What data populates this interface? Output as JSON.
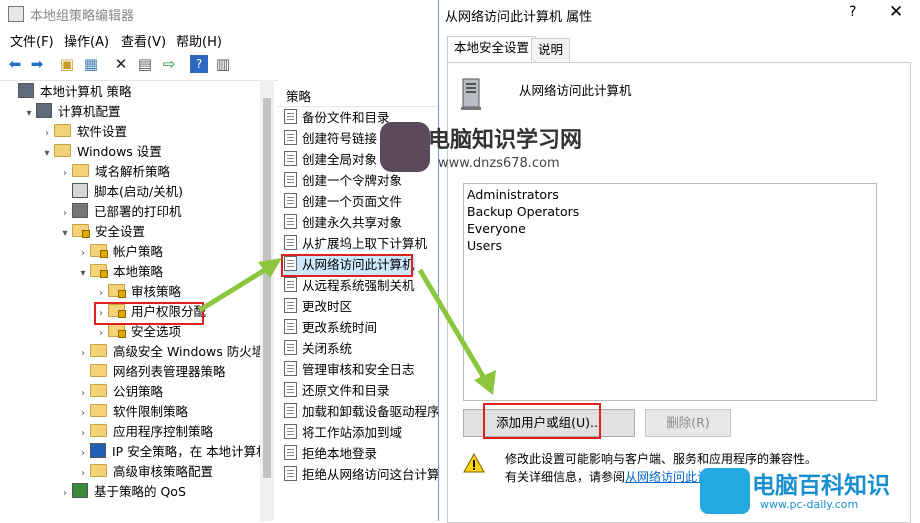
{
  "main_window": {
    "title": "本地组策略编辑器",
    "menus": [
      "文件(F)",
      "操作(A)",
      "查看(V)",
      "帮助(H)"
    ]
  },
  "tree": [
    {
      "label": "本地计算机 策略",
      "indent": 0,
      "arrow": "",
      "icon": "computer"
    },
    {
      "label": "计算机配置",
      "indent": 1,
      "arrow": "▾",
      "icon": "computer"
    },
    {
      "label": "软件设置",
      "indent": 2,
      "arrow": "›",
      "icon": "folder"
    },
    {
      "label": "Windows 设置",
      "indent": 2,
      "arrow": "▾",
      "icon": "folder"
    },
    {
      "label": "域名解析策略",
      "indent": 3,
      "arrow": "›",
      "icon": "folder"
    },
    {
      "label": "脚本(启动/关机)",
      "indent": 3,
      "arrow": "",
      "icon": "script"
    },
    {
      "label": "已部署的打印机",
      "indent": 3,
      "arrow": "›",
      "icon": "printer"
    },
    {
      "label": "安全设置",
      "indent": 3,
      "arrow": "▾",
      "icon": "lockfolder"
    },
    {
      "label": "帐户策略",
      "indent": 4,
      "arrow": "›",
      "icon": "lockfolder"
    },
    {
      "label": "本地策略",
      "indent": 4,
      "arrow": "▾",
      "icon": "lockfolder"
    },
    {
      "label": "审核策略",
      "indent": 5,
      "arrow": "›",
      "icon": "lockfolder"
    },
    {
      "label": "用户权限分配",
      "indent": 5,
      "arrow": "›",
      "icon": "lockfolder",
      "highlight": true
    },
    {
      "label": "安全选项",
      "indent": 5,
      "arrow": "›",
      "icon": "lockfolder"
    },
    {
      "label": "高级安全 Windows 防火墙",
      "indent": 4,
      "arrow": "›",
      "icon": "folder"
    },
    {
      "label": "网络列表管理器策略",
      "indent": 4,
      "arrow": "",
      "icon": "folder"
    },
    {
      "label": "公钥策略",
      "indent": 4,
      "arrow": "›",
      "icon": "folder"
    },
    {
      "label": "软件限制策略",
      "indent": 4,
      "arrow": "›",
      "icon": "folder"
    },
    {
      "label": "应用程序控制策略",
      "indent": 4,
      "arrow": "›",
      "icon": "folder"
    },
    {
      "label": "IP 安全策略，在 本地计算机",
      "indent": 4,
      "arrow": "›",
      "icon": "shield"
    },
    {
      "label": "高级审核策略配置",
      "indent": 4,
      "arrow": "›",
      "icon": "folder"
    },
    {
      "label": "基于策略的 QoS",
      "indent": 3,
      "arrow": "›",
      "icon": "chart"
    }
  ],
  "policy_list": {
    "header": "策略",
    "items": [
      "备份文件和目录",
      "创建符号链接",
      "创建全局对象",
      "创建一个令牌对象",
      "创建一个页面文件",
      "创建永久共享对象",
      "从扩展坞上取下计算机",
      "从网络访问此计算机",
      "从远程系统强制关机",
      "更改时区",
      "更改系统时间",
      "关闭系统",
      "管理审核和安全日志",
      "还原文件和目录",
      "加载和卸载设备驱动程序",
      "将工作站添加到域",
      "拒绝本地登录",
      "拒绝从网络访问这台计算机"
    ],
    "selected_index": 7
  },
  "dialog": {
    "title": "从网络访问此计算机 属性",
    "help": "?",
    "close": "✕",
    "tabs": [
      "本地安全设置",
      "说明"
    ],
    "policy_name": "从网络访问此计算机",
    "accounts": [
      "Administrators",
      "Backup Operators",
      "Everyone",
      "Users"
    ],
    "add_button": "添加用户或组(U)...",
    "remove_button": "删除(R)",
    "warning_line1": "修改此设置可能影响与客户端、服务和应用程序的兼容性。",
    "warning_line2_prefix": "有关详细信息，请参阅",
    "warning_link": "从网络访问此计算"
  },
  "watermark_top": {
    "text": "电脑知识学习网",
    "url": "www.dnzs678.com"
  },
  "watermark_bottom": {
    "text": "电脑百科知识",
    "url": "www.pc-daily.com"
  },
  "colors": {
    "selection": "#cce8ff",
    "highlight_box": "#e02020",
    "arrow_green": "#8cc63f",
    "link": "#0066cc"
  }
}
